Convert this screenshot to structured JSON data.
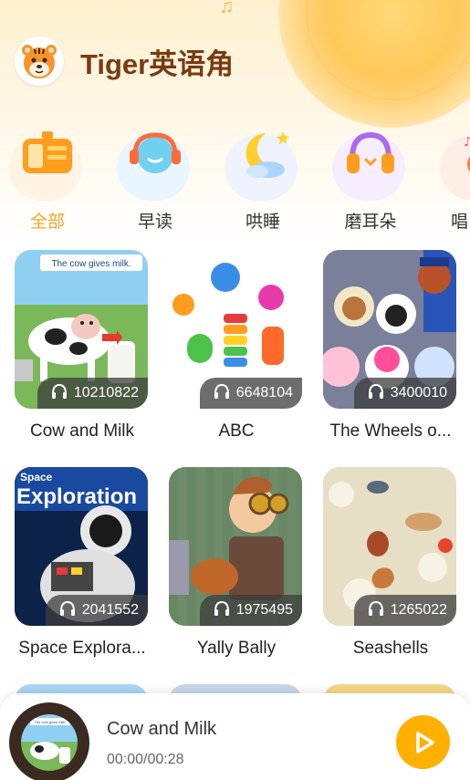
{
  "header": {
    "title": "Tiger英语角",
    "logo_icon": "tiger-logo-icon"
  },
  "categories": [
    {
      "label": "全部",
      "icon": "radio-icon",
      "active": true
    },
    {
      "label": "早读",
      "icon": "headphones-icon",
      "active": false
    },
    {
      "label": "哄睡",
      "icon": "moon-icon",
      "active": false
    },
    {
      "label": "磨耳朵",
      "icon": "headphones-icon",
      "active": false
    },
    {
      "label": "唱",
      "icon": "guitar-icon",
      "active": false
    }
  ],
  "cards": [
    {
      "title": "Cow and Milk",
      "plays": "10210822",
      "caption": "The cow gives milk."
    },
    {
      "title": "ABC",
      "plays": "6648104"
    },
    {
      "title": "The Wheels o...",
      "plays": "3400010"
    },
    {
      "title": "Space Explora...",
      "plays": "2041552",
      "caption": "Space Exploration"
    },
    {
      "title": "Yally Bally",
      "plays": "1975495"
    },
    {
      "title": "Seashells",
      "plays": "1265022"
    }
  ],
  "player": {
    "title": "Cow and Milk",
    "time": "00:00/00:28",
    "play_icon": "play-icon",
    "caption": "The cow gives milk."
  },
  "colors": {
    "accent": "#f5a623",
    "play": "#ffb000",
    "title": "#7a3a12"
  }
}
